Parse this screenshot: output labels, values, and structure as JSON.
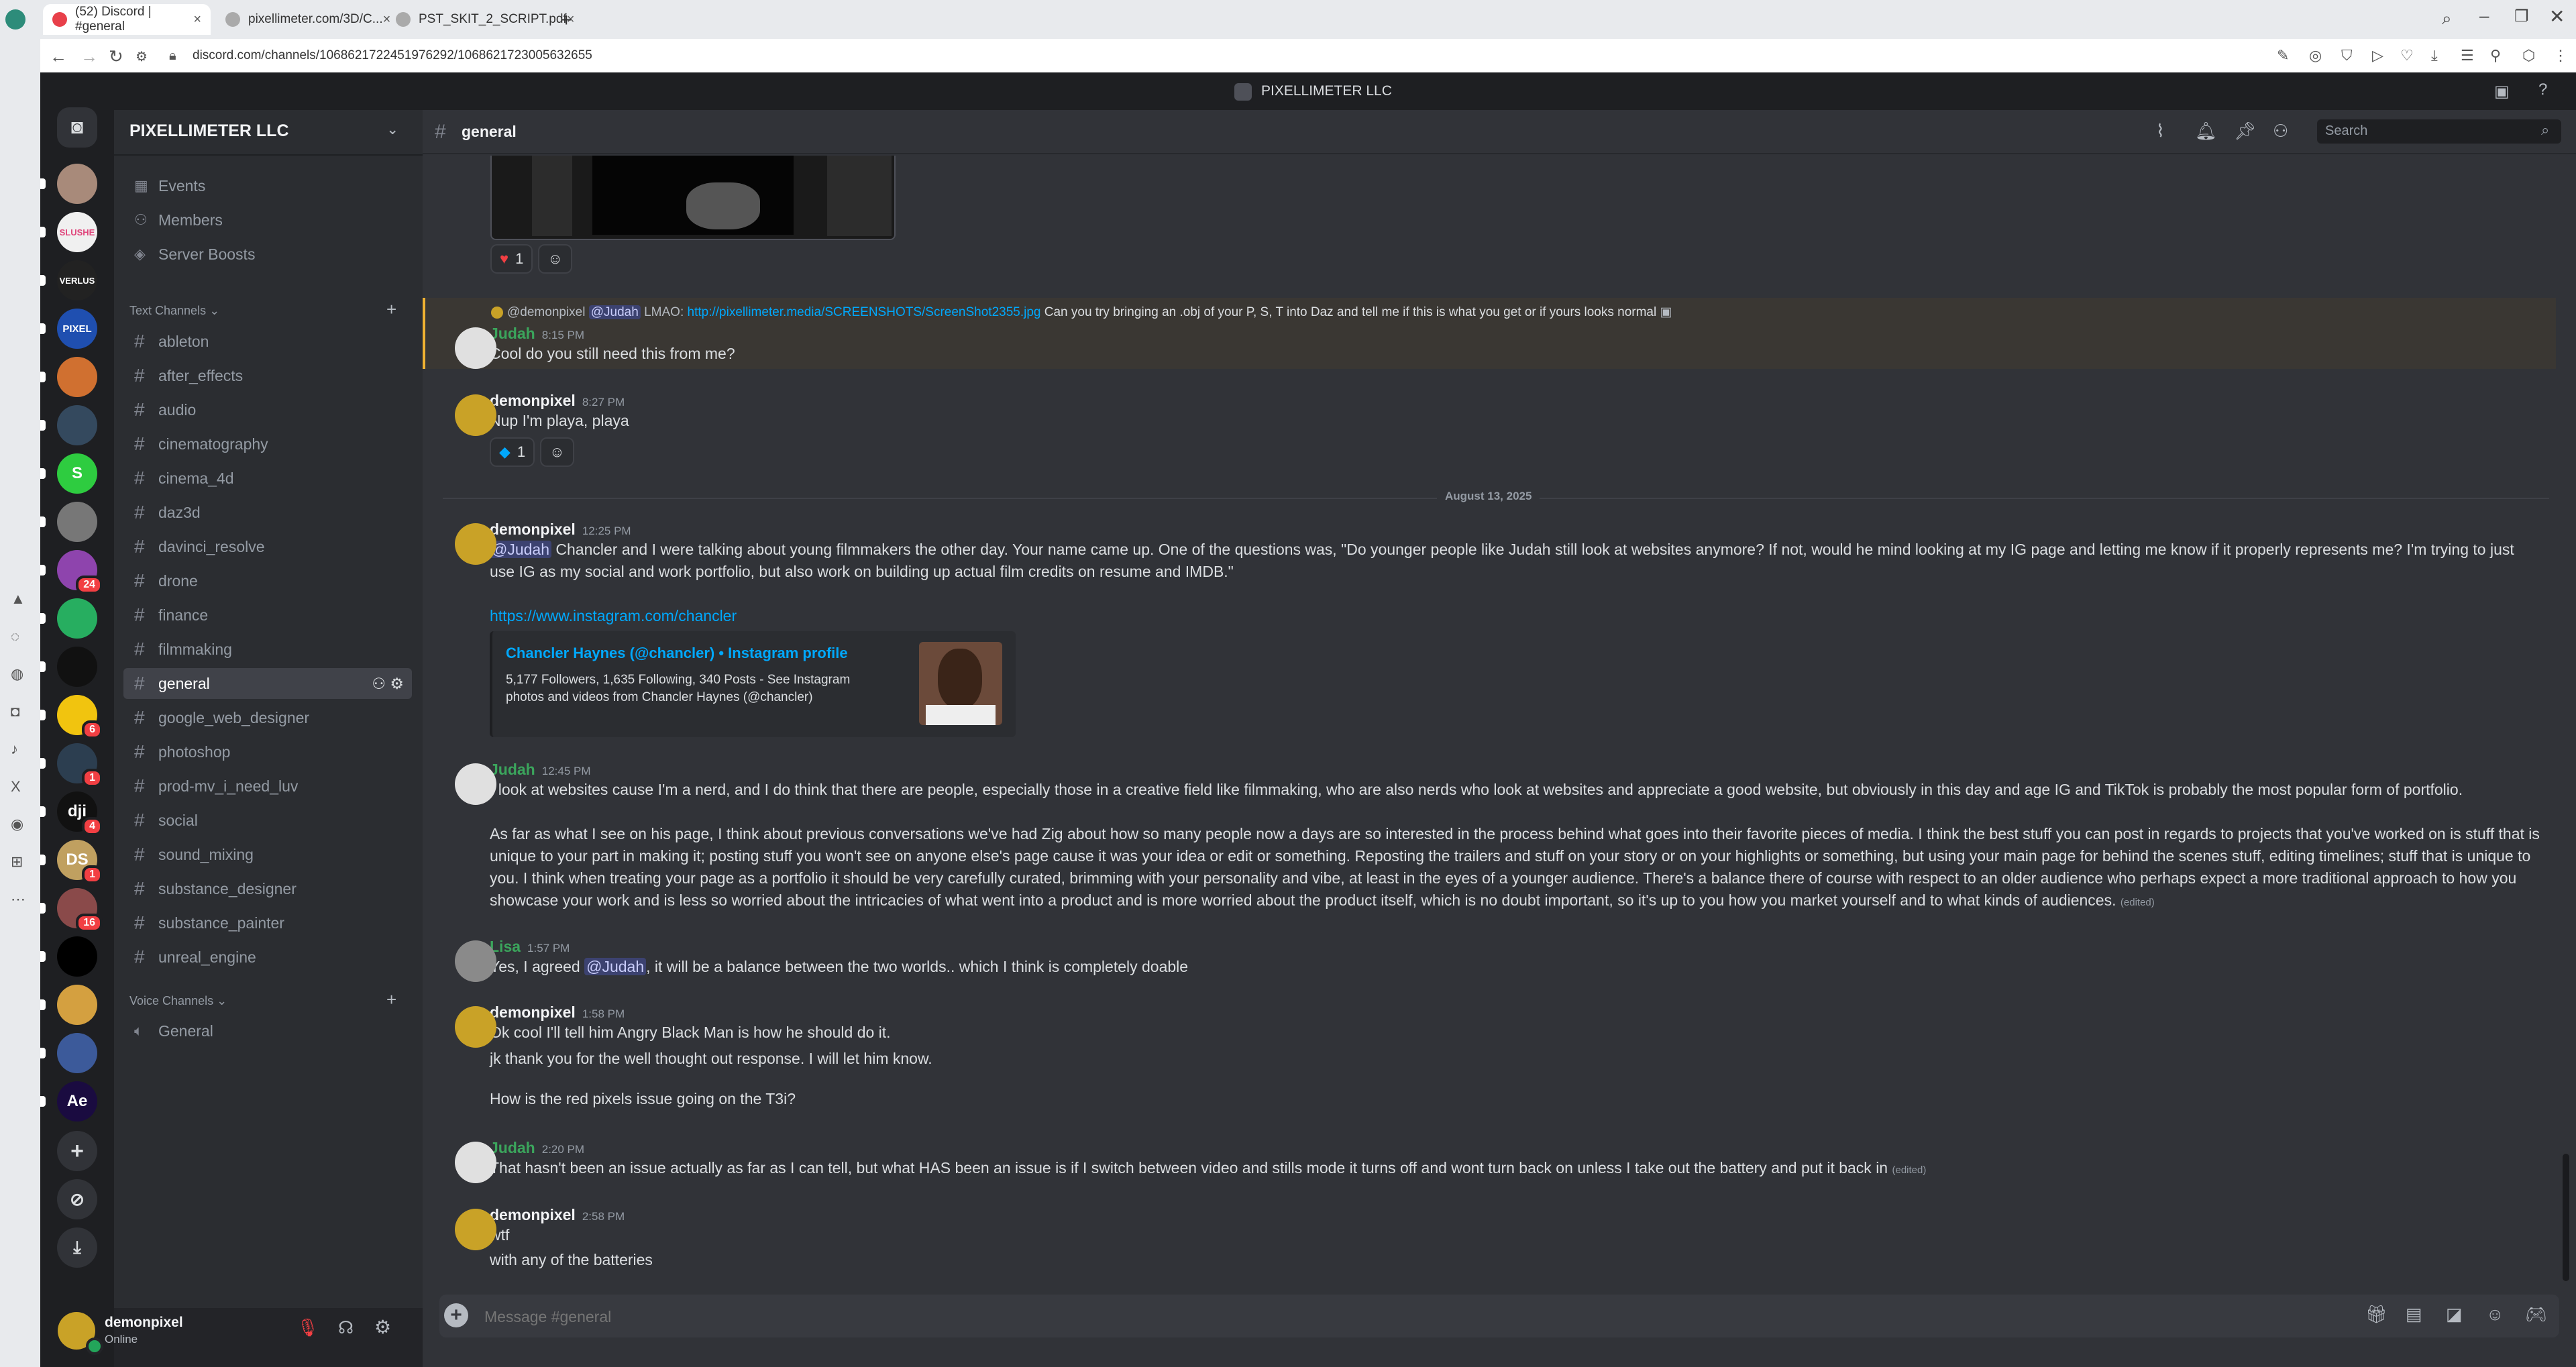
{
  "browser": {
    "tabs": [
      {
        "title": "(52) Discord | #general",
        "active": true
      },
      {
        "title": "pixellimeter.com/3D/C...",
        "active": false
      },
      {
        "title": "PST_SKIT_2_SCRIPT.pdf",
        "active": false
      }
    ],
    "url": "discord.com/channels/1068621722451976292/1068621723005632655"
  },
  "titlebar": {
    "server": "PIXELLIMETER LLC"
  },
  "guilds": [
    {
      "label": "",
      "color": "#a88a7a",
      "badge": ""
    },
    {
      "label": "SLUSHE",
      "color": "#f0f0f0",
      "badge": ""
    },
    {
      "label": "VERLUS",
      "color": "#222222",
      "badge": ""
    },
    {
      "label": "PIXEL",
      "color": "#1f4fb0",
      "badge": ""
    },
    {
      "label": "",
      "color": "#d07030",
      "badge": ""
    },
    {
      "label": "",
      "color": "#34495e",
      "badge": ""
    },
    {
      "label": "S",
      "color": "#2ecc40",
      "badge": ""
    },
    {
      "label": "",
      "color": "#777777",
      "badge": ""
    },
    {
      "label": "",
      "color": "#8e44ad",
      "badge": "24"
    },
    {
      "label": "",
      "color": "#27ae60",
      "badge": ""
    },
    {
      "label": "",
      "color": "#111111",
      "badge": ""
    },
    {
      "label": "",
      "color": "#f1c40f",
      "badge": "6"
    },
    {
      "label": "",
      "color": "#2c3e50",
      "badge": "1"
    },
    {
      "label": "dji",
      "color": "#111111",
      "badge": "4"
    },
    {
      "label": "DS",
      "color": "#c0a060",
      "badge": "1"
    },
    {
      "label": "",
      "color": "#8a4a4a",
      "badge": "16"
    },
    {
      "label": "",
      "color": "#000000",
      "badge": ""
    },
    {
      "label": "",
      "color": "#d4a040",
      "badge": ""
    },
    {
      "label": "",
      "color": "#3c5a9a",
      "badge": ""
    },
    {
      "label": "Ae",
      "color": "#1a0b40",
      "badge": ""
    }
  ],
  "sidebar": {
    "server_name": "PIXELLIMETER LLC",
    "top_items": [
      {
        "label": "Events",
        "icon": "calendar-icon"
      },
      {
        "label": "Members",
        "icon": "members-icon"
      },
      {
        "label": "Server Boosts",
        "icon": "boost-icon"
      }
    ],
    "text_category": "Text Channels",
    "channels": [
      "ableton",
      "after_effects",
      "audio",
      "cinematography",
      "cinema_4d",
      "daz3d",
      "davinci_resolve",
      "drone",
      "finance",
      "filmmaking",
      "general",
      "google_web_designer",
      "photoshop",
      "prod-mv_i_need_luv",
      "social",
      "sound_mixing",
      "substance_designer",
      "substance_painter",
      "unreal_engine"
    ],
    "selected": "general",
    "voice_category": "Voice Channels",
    "voice_channels": [
      "General"
    ]
  },
  "user": {
    "name": "demonpixel",
    "status": "Online"
  },
  "header": {
    "channel": "general",
    "search_placeholder": "Search"
  },
  "messages": {
    "reaction_heart": "1",
    "reply_author": "@demonpixel",
    "reply_mention": "@Judah",
    "reply_pre": "LMAO:",
    "reply_link": "http://pixellimeter.media/SCREENSHOTS/ScreenShot2355.jpg",
    "reply_post": "Can you try bringing an .obj of your P, S, T into Daz and tell me if this is what you get or if yours looks normal",
    "m1_author": "Judah",
    "m1_time": "8:15 PM",
    "m1_text": "Cool do you still need this from me?",
    "m2_author": "demonpixel",
    "m2_time": "8:27 PM",
    "m2_text": "Nup I'm playa, playa",
    "m2_reaction": "1",
    "divider": "August 13, 2025",
    "m3_author": "demonpixel",
    "m3_time": "12:25 PM",
    "m3_mention": "@Judah",
    "m3_text": " Chancler and I were talking about young filmmakers the other day. Your name came up. One of the questions was, \"Do younger people like Judah still look at websites anymore? If not, would he mind looking at my IG page and letting me know if it properly represents me? I'm trying to just use IG as my social and work portfolio, but also work on building up actual film credits on resume and IMDB.\"",
    "m3_link": "https://www.instagram.com/chancler",
    "embed_title": "Chancler Haynes (@chancler) • Instagram profile",
    "embed_desc": "5,177 Followers, 1,635 Following, 340 Posts - See Instagram photos and videos from Chancler Haynes (@chancler)",
    "m4_author": "Judah",
    "m4_time": "12:45 PM",
    "m4_p1": "I look at websites cause I'm a nerd, and I do think that there are people, especially those in a creative field like filmmaking, who are also nerds who look at websites and appreciate a good website, but obviously in this day and age IG and TikTok is probably the most popular form of portfolio.",
    "m4_p2": "As far as what I see on his page, I think about previous conversations we've had Zig about how so many people now a days are so interested in the process behind what goes into their favorite pieces of media. I think the best stuff you can post in regards to projects that you've worked on is stuff that is unique to your part in making it; posting stuff you won't see on anyone else's page cause it was your idea or edit or something. Reposting the trailers and stuff on your story or on your highlights or something, but using your main page for behind the scenes stuff, editing timelines; stuff that is unique to you. I think when treating your page as a portfolio it should be very carefully curated, brimming with your personality and vibe, at least in the eyes of a younger audience. There's a balance there of course with respect to an older audience who perhaps expect a more traditional approach to how you showcase your work and is less so worried about the intricacies of what went into a product and is more worried about the product itself, which is no doubt important, so it's up to you how you market yourself and to what kinds of audiences.",
    "edited": "(edited)",
    "m5_author": "Lisa",
    "m5_time": "1:57 PM",
    "m5_pre": "Yes, I agreed ",
    "m5_mention": "@Judah",
    "m5_post": ", it will be a balance between the two worlds.. which I think is completely doable",
    "m6_author": "demonpixel",
    "m6_time": "1:58 PM",
    "m6_l1": "Ok cool I'll tell him Angry Black Man is how he should do it.",
    "m6_l2": "jk thank you for the well thought out response. I will let him know.",
    "m6_l3": "How is the red pixels issue going on the T3i?",
    "m7_author": "Judah",
    "m7_time": "2:20 PM",
    "m7_text": "That hasn't been an issue actually as far as I can tell, but what HAS been an issue is if I switch between video and stills mode it turns off and wont turn back on unless I take out the battery and put it back in",
    "m8_author": "demonpixel",
    "m8_time": "2:58 PM",
    "m8_l1": "wtf",
    "m8_l2": "with any of the batteries"
  },
  "composer": {
    "placeholder": "Message #general"
  }
}
